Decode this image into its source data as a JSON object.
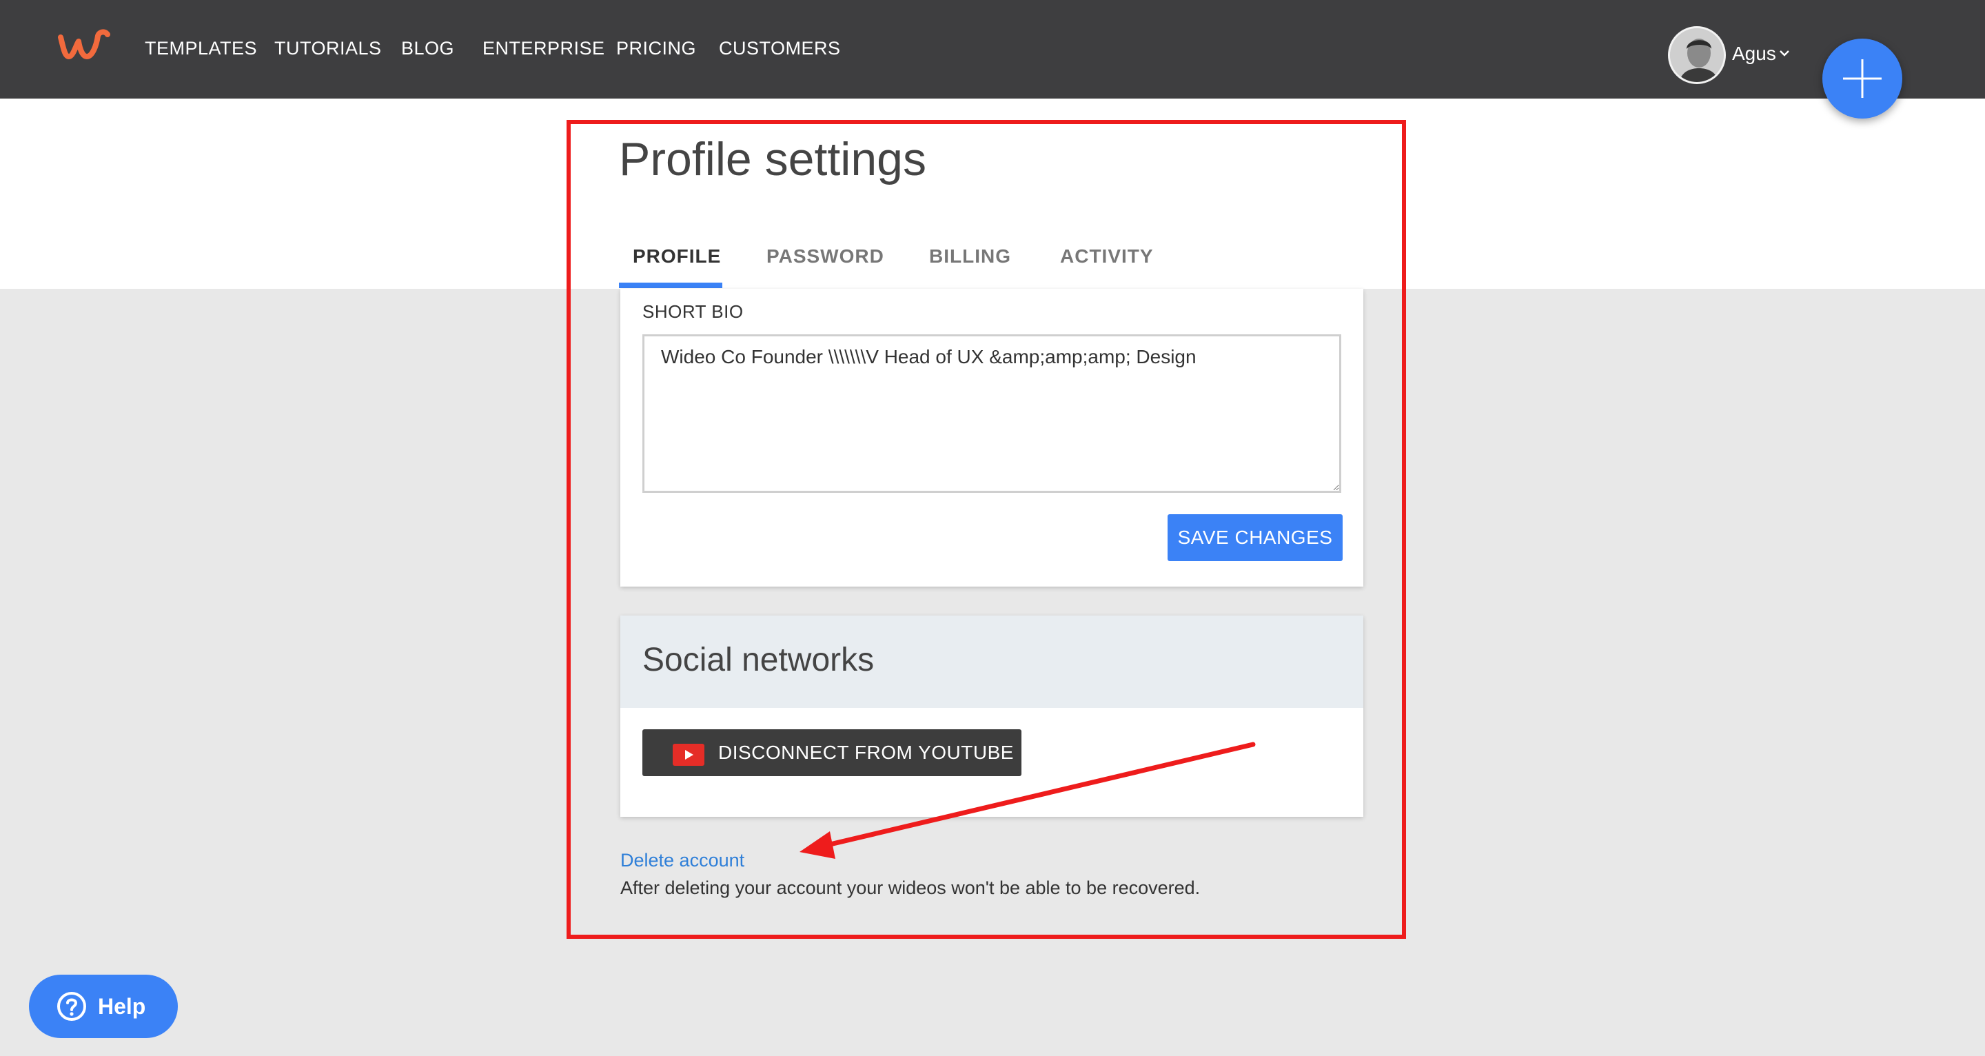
{
  "nav": {
    "logo_icon": "wideo-logo-icon",
    "items": [
      {
        "label": "TEMPLATES"
      },
      {
        "label": "TUTORIALS"
      },
      {
        "label": "BLOG"
      },
      {
        "label": "ENTERPRISE"
      },
      {
        "label": "PRICING"
      },
      {
        "label": "CUSTOMERS"
      }
    ],
    "user_name": "Agus",
    "add_button_icon": "plus-icon"
  },
  "page": {
    "title": "Profile settings",
    "tabs": [
      {
        "label": "PROFILE",
        "active": true
      },
      {
        "label": "PASSWORD",
        "active": false
      },
      {
        "label": "BILLING",
        "active": false
      },
      {
        "label": "ACTIVITY",
        "active": false
      }
    ]
  },
  "bio": {
    "label": "SHORT BIO",
    "value": "Wideo Co Founder \\\\\\\\\\\\\\V Head of UX &amp;amp;amp; Design",
    "save_label": "SAVE CHANGES"
  },
  "social": {
    "title": "Social networks",
    "youtube_label": "DISCONNECT FROM YOUTUBE",
    "youtube_icon": "youtube-icon"
  },
  "delete": {
    "link": "Delete account",
    "note": "After deleting your account your wideos won't be able to be recovered."
  },
  "help": {
    "label": "Help",
    "icon": "question-circle-icon"
  },
  "colors": {
    "navbar": "#3e3e40",
    "accent": "#3b82f6",
    "annotation": "#ee1c1c",
    "logo": "#f26a3d"
  }
}
